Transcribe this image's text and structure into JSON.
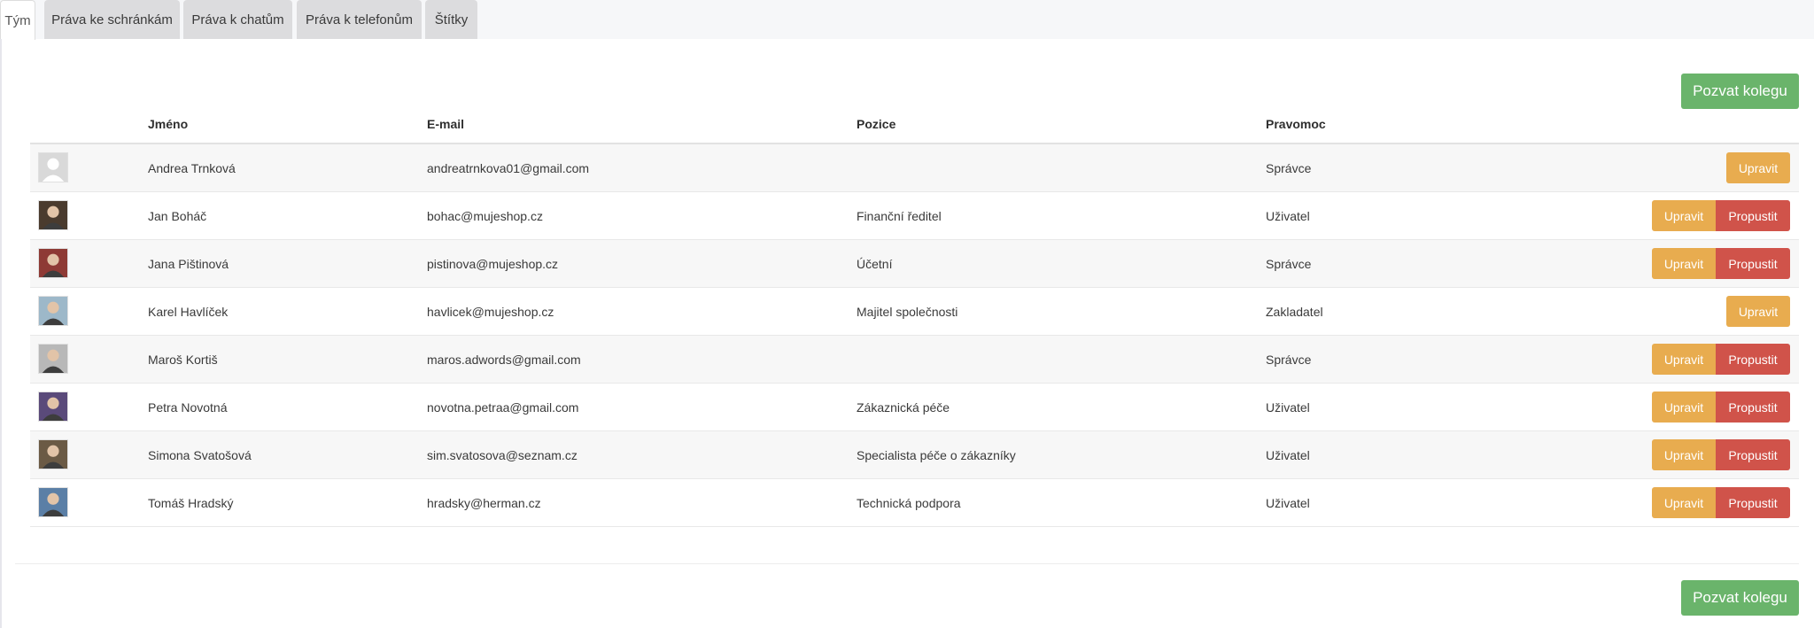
{
  "tabs": [
    {
      "label": "Tým",
      "active": true
    },
    {
      "label": "Práva ke schránkám",
      "active": false
    },
    {
      "label": "Práva k chatům",
      "active": false
    },
    {
      "label": "Práva k telefonům",
      "active": false
    },
    {
      "label": "Štítky",
      "active": false
    }
  ],
  "invite_top_label": "Pozvat kolegu",
  "invite_bottom_label": "Pozvat kolegu",
  "table": {
    "columns": {
      "name": "Jméno",
      "email": "E-mail",
      "position": "Pozice",
      "role": "Pravomoc"
    },
    "rows": [
      {
        "name": "Andrea Trnková",
        "email": "andreatrnkova01@gmail.com",
        "position": "",
        "role": "Správce",
        "edit_label": "Upravit",
        "fire_label": null,
        "avatar": "placeholder-avatar-icon",
        "avatar_color": "#c9c9c9"
      },
      {
        "name": "Jan Boháč",
        "email": "bohac@mujeshop.cz",
        "position": "Finanční ředitel",
        "role": "Uživatel",
        "edit_label": "Upravit",
        "fire_label": "Propustit",
        "avatar": "photo-avatar",
        "avatar_color": "#4a3b2e"
      },
      {
        "name": "Jana Pištinová",
        "email": "pistinova@mujeshop.cz",
        "position": "Účetní",
        "role": "Správce",
        "edit_label": "Upravit",
        "fire_label": "Propustit",
        "avatar": "photo-avatar",
        "avatar_color": "#8e3a35"
      },
      {
        "name": "Karel Havlíček",
        "email": "havlicek@mujeshop.cz",
        "position": "Majitel společnosti",
        "role": "Zakladatel",
        "edit_label": "Upravit",
        "fire_label": null,
        "avatar": "photo-avatar",
        "avatar_color": "#9db8c9"
      },
      {
        "name": "Maroš Kortiš",
        "email": "maros.adwords@gmail.com",
        "position": "",
        "role": "Správce",
        "edit_label": "Upravit",
        "fire_label": "Propustit",
        "avatar": "photo-avatar",
        "avatar_color": "#b8b8b8"
      },
      {
        "name": "Petra Novotná",
        "email": "novotna.petraa@gmail.com",
        "position": "Zákaznická péče",
        "role": "Uživatel",
        "edit_label": "Upravit",
        "fire_label": "Propustit",
        "avatar": "photo-avatar",
        "avatar_color": "#5a4a7a"
      },
      {
        "name": "Simona Svatošová",
        "email": "sim.svatosova@seznam.cz",
        "position": "Specialista péče o zákazníky",
        "role": "Uživatel",
        "edit_label": "Upravit",
        "fire_label": "Propustit",
        "avatar": "photo-avatar",
        "avatar_color": "#6b5a45"
      },
      {
        "name": "Tomáš Hradský",
        "email": "hradsky@herman.cz",
        "position": "Technická podpora",
        "role": "Uživatel",
        "edit_label": "Upravit",
        "fire_label": "Propustit",
        "avatar": "photo-avatar",
        "avatar_color": "#5b7fa6"
      }
    ]
  },
  "colors": {
    "invite": "#6ab46b",
    "edit": "#e8ac4f",
    "fire": "#d0534a"
  }
}
